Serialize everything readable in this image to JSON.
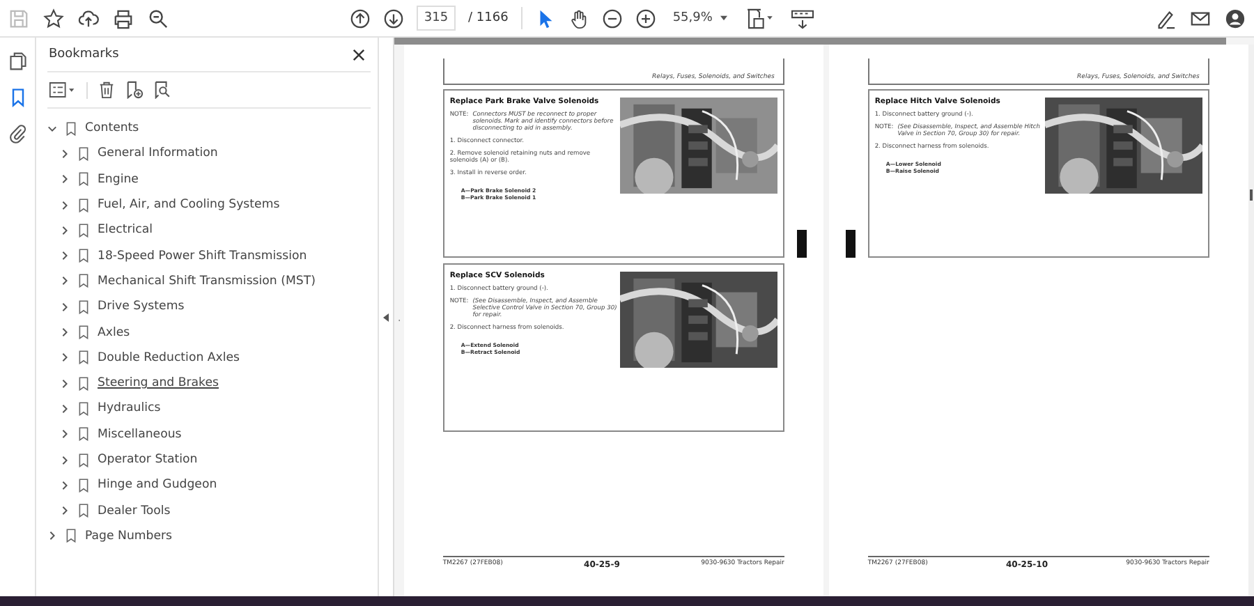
{
  "toolbar": {
    "page_number": "315",
    "page_total": "/ 1166",
    "zoom": "55,9%"
  },
  "sidebar": {
    "rail": [
      {
        "kind": "pages",
        "selected": false
      },
      {
        "kind": "bookmarks",
        "selected": true
      },
      {
        "kind": "attachments",
        "selected": false
      }
    ],
    "panel_title": "Bookmarks",
    "bookmarks": [
      {
        "label": "Contents",
        "expanded": true,
        "children": [
          {
            "label": "General Information",
            "expanded": false,
            "hovered": false
          },
          {
            "label": "Engine",
            "expanded": false,
            "hovered": false
          },
          {
            "label": "Fuel, Air, and Cooling Systems",
            "expanded": false,
            "hovered": false
          },
          {
            "label": "Electrical",
            "expanded": false,
            "hovered": false
          },
          {
            "label": "18-Speed Power Shift Transmission",
            "expanded": false,
            "hovered": false
          },
          {
            "label": "Mechanical Shift Transmission (MST)",
            "expanded": false,
            "hovered": false
          },
          {
            "label": "Drive Systems",
            "expanded": false,
            "hovered": false
          },
          {
            "label": "Axles",
            "expanded": false,
            "hovered": false
          },
          {
            "label": "Double Reduction Axles",
            "expanded": false,
            "hovered": false
          },
          {
            "label": "Steering and Brakes",
            "expanded": false,
            "hovered": true
          },
          {
            "label": "Hydraulics",
            "expanded": false,
            "hovered": false
          },
          {
            "label": "Miscellaneous",
            "expanded": false,
            "hovered": false
          },
          {
            "label": "Operator Station",
            "expanded": false,
            "hovered": false
          },
          {
            "label": "Hinge and Gudgeon",
            "expanded": false,
            "hovered": false
          },
          {
            "label": "Dealer Tools",
            "expanded": false,
            "hovered": false
          }
        ]
      },
      {
        "label": "Page Numbers",
        "expanded": false
      }
    ]
  },
  "pages": [
    {
      "header": "Relays, Fuses, Solenoids, and Switches",
      "sections": [
        {
          "title": "Replace Park Brake Valve Solenoids",
          "steps": [
            {
              "kind": "note",
              "label": "NOTE:",
              "text": "Connectors MUST be reconnect to proper solenoids. Mark and identify connectors before disconnecting to aid in assembly."
            },
            {
              "kind": "step",
              "text": "1. Disconnect connector."
            },
            {
              "kind": "step",
              "text": "2. Remove solenoid retaining nuts and remove solenoids (A) or (B)."
            },
            {
              "kind": "step",
              "text": "3. Install in reverse order."
            }
          ],
          "legend": [
            "A—Park Brake Solenoid 2",
            "B—Park Brake Solenoid 1"
          ]
        },
        {
          "title": "Replace SCV Solenoids",
          "steps": [
            {
              "kind": "step",
              "text": "1. Disconnect battery ground (-)."
            },
            {
              "kind": "note",
              "label": "NOTE:",
              "text": "(See Disassemble, Inspect, and Assemble Selective Control Valve in Section 70, Group 30) for repair."
            },
            {
              "kind": "step",
              "text": "2. Disconnect harness from solenoids."
            }
          ],
          "legend": [
            "A—Extend Solenoid",
            "B—Retract Solenoid"
          ]
        }
      ],
      "footer": {
        "left": "TM2267 (27FEB08)",
        "center": "40-25-9",
        "right": "9030-9630 Tractors Repair"
      }
    },
    {
      "header": "Relays, Fuses, Solenoids, and Switches",
      "sections": [
        {
          "title": "Replace Hitch Valve Solenoids",
          "steps": [
            {
              "kind": "step",
              "text": "1. Disconnect battery ground (-)."
            },
            {
              "kind": "note",
              "label": "NOTE:",
              "text": "(See Disassemble, Inspect, and Assemble Hitch Valve in Section 70, Group 30) for repair."
            },
            {
              "kind": "step",
              "text": "2. Disconnect harness from solenoids."
            }
          ],
          "legend": [
            "A—Lower Solenoid",
            "B—Raise Solenoid"
          ]
        }
      ],
      "footer": {
        "left": "TM2267 (27FEB08)",
        "center": "40-25-10",
        "right": "9030-9630 Tractors Repair"
      }
    }
  ]
}
